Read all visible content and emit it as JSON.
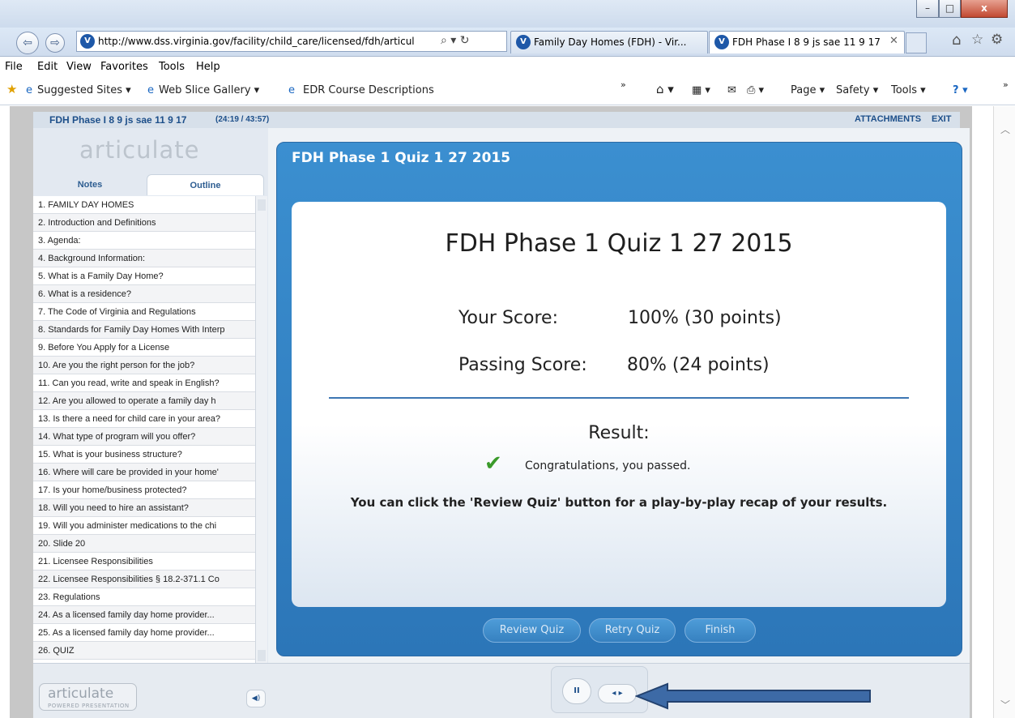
{
  "browser": {
    "url": "http://www.dss.virginia.gov/facility/child_care/licensed/fdh/articul",
    "url_host_bold": "virginia",
    "tabs": [
      {
        "label": "Family Day Homes (FDH) - Vir...",
        "active": false
      },
      {
        "label": "FDH Phase I 8 9 js sae 11 9 17",
        "active": true
      }
    ],
    "menu": [
      "File",
      "Edit",
      "View",
      "Favorites",
      "Tools",
      "Help"
    ],
    "favorites": [
      "Suggested Sites ▾",
      "Web Slice Gallery ▾",
      "EDR Course Descriptions"
    ],
    "command_bar": [
      "Page ▾",
      "Safety ▾",
      "Tools ▾"
    ],
    "window_buttons": [
      "–",
      "□",
      "x"
    ]
  },
  "player": {
    "course_title": "FDH Phase I 8 9 js sae 11 9 17",
    "time": "(24:19 / 43:57)",
    "links": [
      "ATTACHMENTS",
      "EXIT"
    ],
    "logo_text": "articulate",
    "logo_small": "articulate",
    "logo_small_sub": "POWERED PRESENTATION",
    "tabs": [
      "Notes",
      "Outline"
    ],
    "outline": [
      "1. FAMILY DAY HOMES",
      "2. Introduction and Definitions",
      "3. Agenda:",
      "4. Background Information:",
      "5. What is a Family Day Home?",
      "6. What is a residence?",
      "7. The Code of Virginia and Regulations",
      "8. Standards for Family Day Homes With Interp",
      "9. Before You Apply for a License",
      "10. Are you the right person for the job?",
      "11. Can you read, write and speak in English?",
      "12. Are you allowed to operate a family day h",
      "13. Is there a need for child care in your area?",
      "14. What type of program will you offer?",
      "15. What is your business structure?",
      "16. Where will care be provided in your home'",
      "17. Is your home/business protected?",
      "18. Will you need to hire an assistant?",
      "19. Will you administer medications to the chi",
      "20. Slide 20",
      "21. Licensee Responsibilities",
      "22. Licensee Responsibilities § 18.2-371.1 Co",
      "23. Regulations",
      "24. As a licensed family day home provider...",
      "25. As a licensed family day home provider...",
      "26. QUIZ"
    ]
  },
  "quiz": {
    "header": "FDH Phase 1 Quiz 1 27 2015",
    "title": "FDH Phase 1 Quiz 1 27 2015",
    "your_score_label": "Your Score:",
    "your_score_value": "100% (30 points)",
    "passing_score_label": "Passing Score:",
    "passing_score_value": "80% (24 points)",
    "result_label": "Result:",
    "result_message": "Congratulations, you passed.",
    "review_message": "You can click the 'Review Quiz' button for a play-by-play recap of your results.",
    "buttons": [
      "Review Quiz",
      "Retry Quiz",
      "Finish"
    ]
  },
  "controls": {
    "pause": "II",
    "prev_next": "◂ ▸",
    "volume": "◀)"
  }
}
